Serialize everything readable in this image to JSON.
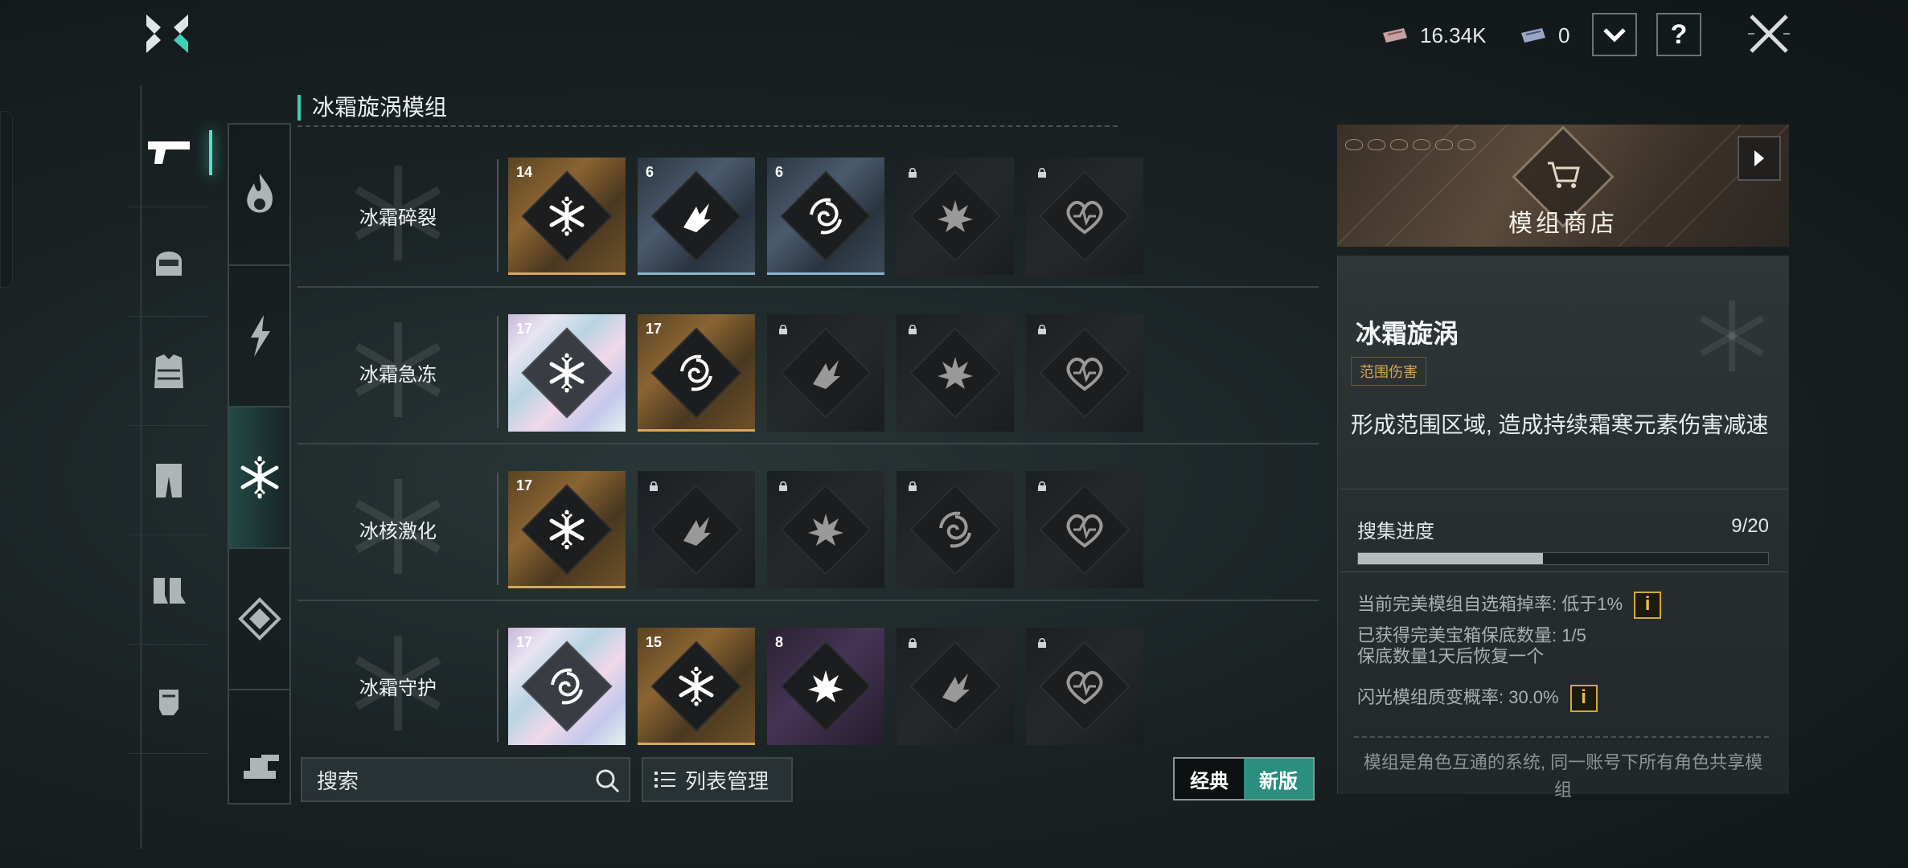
{
  "topbar": {
    "currency1_value": "16.34K",
    "currency2_value": "0",
    "dropdown_icon": "chevron-down-icon",
    "help_label": "?",
    "close_icon": "close-icon"
  },
  "section_title": "冰霜旋涡模组",
  "rows": [
    {
      "name": "冰霜碎裂",
      "cards": [
        {
          "rarity": "gold",
          "icon": "snowflake",
          "count": "14",
          "locked": false
        },
        {
          "rarity": "blue",
          "icon": "arrow-burst",
          "count": "6",
          "locked": false
        },
        {
          "rarity": "blue",
          "icon": "vortex",
          "count": "6",
          "locked": false
        },
        {
          "rarity": "dark",
          "icon": "explosion",
          "count": "",
          "locked": true
        },
        {
          "rarity": "dark",
          "icon": "heart",
          "count": "",
          "locked": true
        }
      ]
    },
    {
      "name": "冰霜急冻",
      "cards": [
        {
          "rarity": "holo",
          "icon": "snowflake",
          "count": "17",
          "locked": false
        },
        {
          "rarity": "gold",
          "icon": "vortex",
          "count": "17",
          "locked": false
        },
        {
          "rarity": "dark",
          "icon": "arrow-burst",
          "count": "",
          "locked": true
        },
        {
          "rarity": "dark",
          "icon": "explosion",
          "count": "",
          "locked": true
        },
        {
          "rarity": "dark",
          "icon": "heart",
          "count": "",
          "locked": true
        }
      ]
    },
    {
      "name": "冰核激化",
      "cards": [
        {
          "rarity": "gold",
          "icon": "snowflake",
          "count": "17",
          "locked": false
        },
        {
          "rarity": "dark",
          "icon": "arrow-burst",
          "count": "",
          "locked": true
        },
        {
          "rarity": "dark",
          "icon": "explosion",
          "count": "",
          "locked": true
        },
        {
          "rarity": "dark",
          "icon": "vortex",
          "count": "",
          "locked": true
        },
        {
          "rarity": "dark",
          "icon": "heart",
          "count": "",
          "locked": true
        }
      ]
    },
    {
      "name": "冰霜守护",
      "cards": [
        {
          "rarity": "holo",
          "icon": "vortex",
          "count": "17",
          "locked": false
        },
        {
          "rarity": "gold",
          "icon": "snowflake",
          "count": "15",
          "locked": false
        },
        {
          "rarity": "purple",
          "icon": "explosion",
          "count": "8",
          "locked": false
        },
        {
          "rarity": "dark",
          "icon": "arrow-burst",
          "count": "",
          "locked": true
        },
        {
          "rarity": "dark",
          "icon": "heart",
          "count": "",
          "locked": true
        }
      ]
    }
  ],
  "search": {
    "placeholder": "搜索"
  },
  "list_mgmt_label": "列表管理",
  "mode_toggle": {
    "classic": "经典",
    "new": "新版",
    "active": "new"
  },
  "shop": {
    "title": "模组商店"
  },
  "detail": {
    "name": "冰霜旋涡",
    "tag": "范围伤害",
    "description": "形成范围区域, 造成持续霜寒元素伤害减速",
    "progress_label": "搜集进度",
    "progress_value": "9/20",
    "progress_fraction": 0.45,
    "info1": "当前完美模组自选箱掉率: 低于1%",
    "info2a": "已获得完美宝箱保底数量: 1/5",
    "info2b": "保底数量1天后恢复一个",
    "info3": "闪光模组质变概率: 30.0%",
    "info_badge": "i",
    "footer": "模组是角色互通的系统, 同一账号下所有角色共享模组"
  },
  "colors": {
    "accent": "#3fcfb5",
    "gold": "#d8a75a",
    "tag": "#d7a25a",
    "info": "#d4a93a"
  }
}
